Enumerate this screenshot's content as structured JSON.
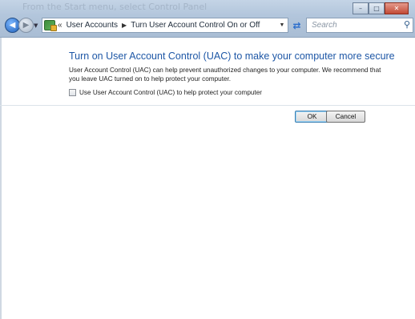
{
  "window": {
    "ghost_title": "From the Start menu, select Control Panel",
    "buttons": [
      "minimize",
      "maximize",
      "close"
    ]
  },
  "nav": {
    "back_icon": "back-arrow-icon",
    "forward_icon": "forward-arrow-icon",
    "address": {
      "overflow": "«",
      "crumb1": "User Accounts",
      "crumb2": "Turn User Account Control On or Off"
    },
    "search_placeholder": "Search"
  },
  "page": {
    "heading": "Turn on User Account Control (UAC) to make your computer more secure",
    "description": "User Account Control (UAC) can help prevent unauthorized changes to your computer.  We recommend that you leave UAC turned on to help protect your computer.",
    "checkbox_label": "Use User Account Control (UAC) to help protect your computer",
    "checkbox_checked": false
  },
  "actions": {
    "ok": "OK",
    "cancel": "Cancel"
  },
  "colors": {
    "heading": "#1e57a6",
    "titlebar": "#b3c6dc"
  }
}
